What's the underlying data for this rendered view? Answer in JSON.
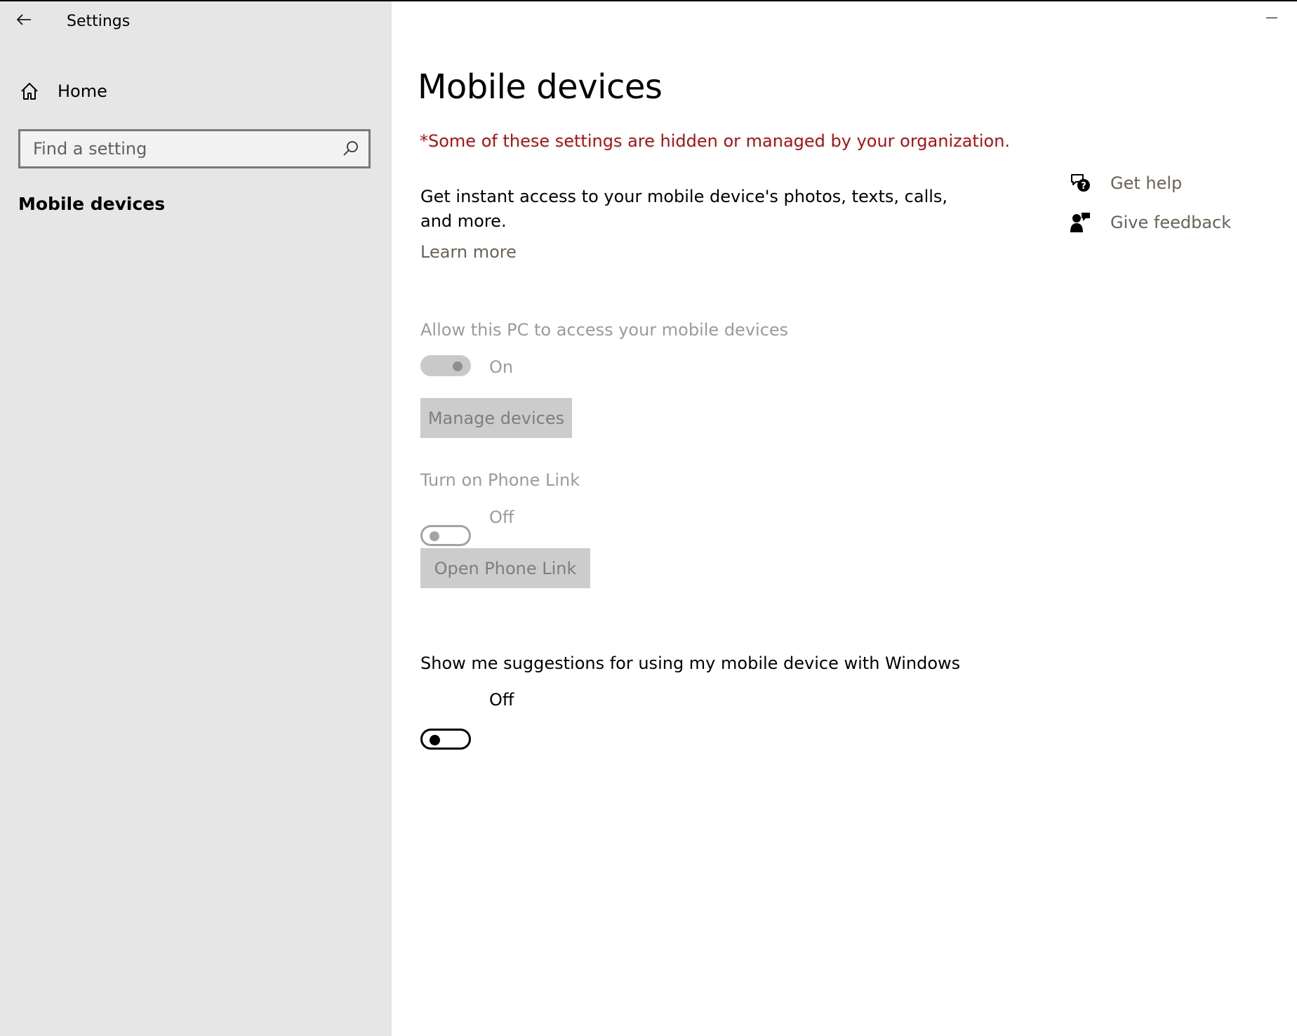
{
  "window": {
    "title": "Settings"
  },
  "sidebar": {
    "home_label": "Home",
    "search_placeholder": "Find a setting",
    "section_title": "Mobile devices"
  },
  "main": {
    "page_title": "Mobile devices",
    "managed_warning": "*Some of these settings are hidden or managed by your organization.",
    "description": "Get instant access to your mobile device's photos, texts, calls, and more.",
    "learn_more": "Learn more",
    "allow_access": {
      "label": "Allow this PC to access your mobile devices",
      "state": "On",
      "enabled": false,
      "button": "Manage devices"
    },
    "phone_link": {
      "label": "Turn on Phone Link",
      "state": "Off",
      "enabled": false,
      "button": "Open Phone Link"
    },
    "suggestions": {
      "label": "Show me suggestions for using my mobile device with Windows",
      "state": "Off",
      "enabled": true
    }
  },
  "help": {
    "get_help": "Get help",
    "give_feedback": "Give feedback"
  },
  "colors": {
    "sidebar_bg": "#e6e6e6",
    "warning": "#b00f0f",
    "link": "#6b6257",
    "disabled_text": "#9b9b9b",
    "disabled_button": "#cccccc"
  }
}
